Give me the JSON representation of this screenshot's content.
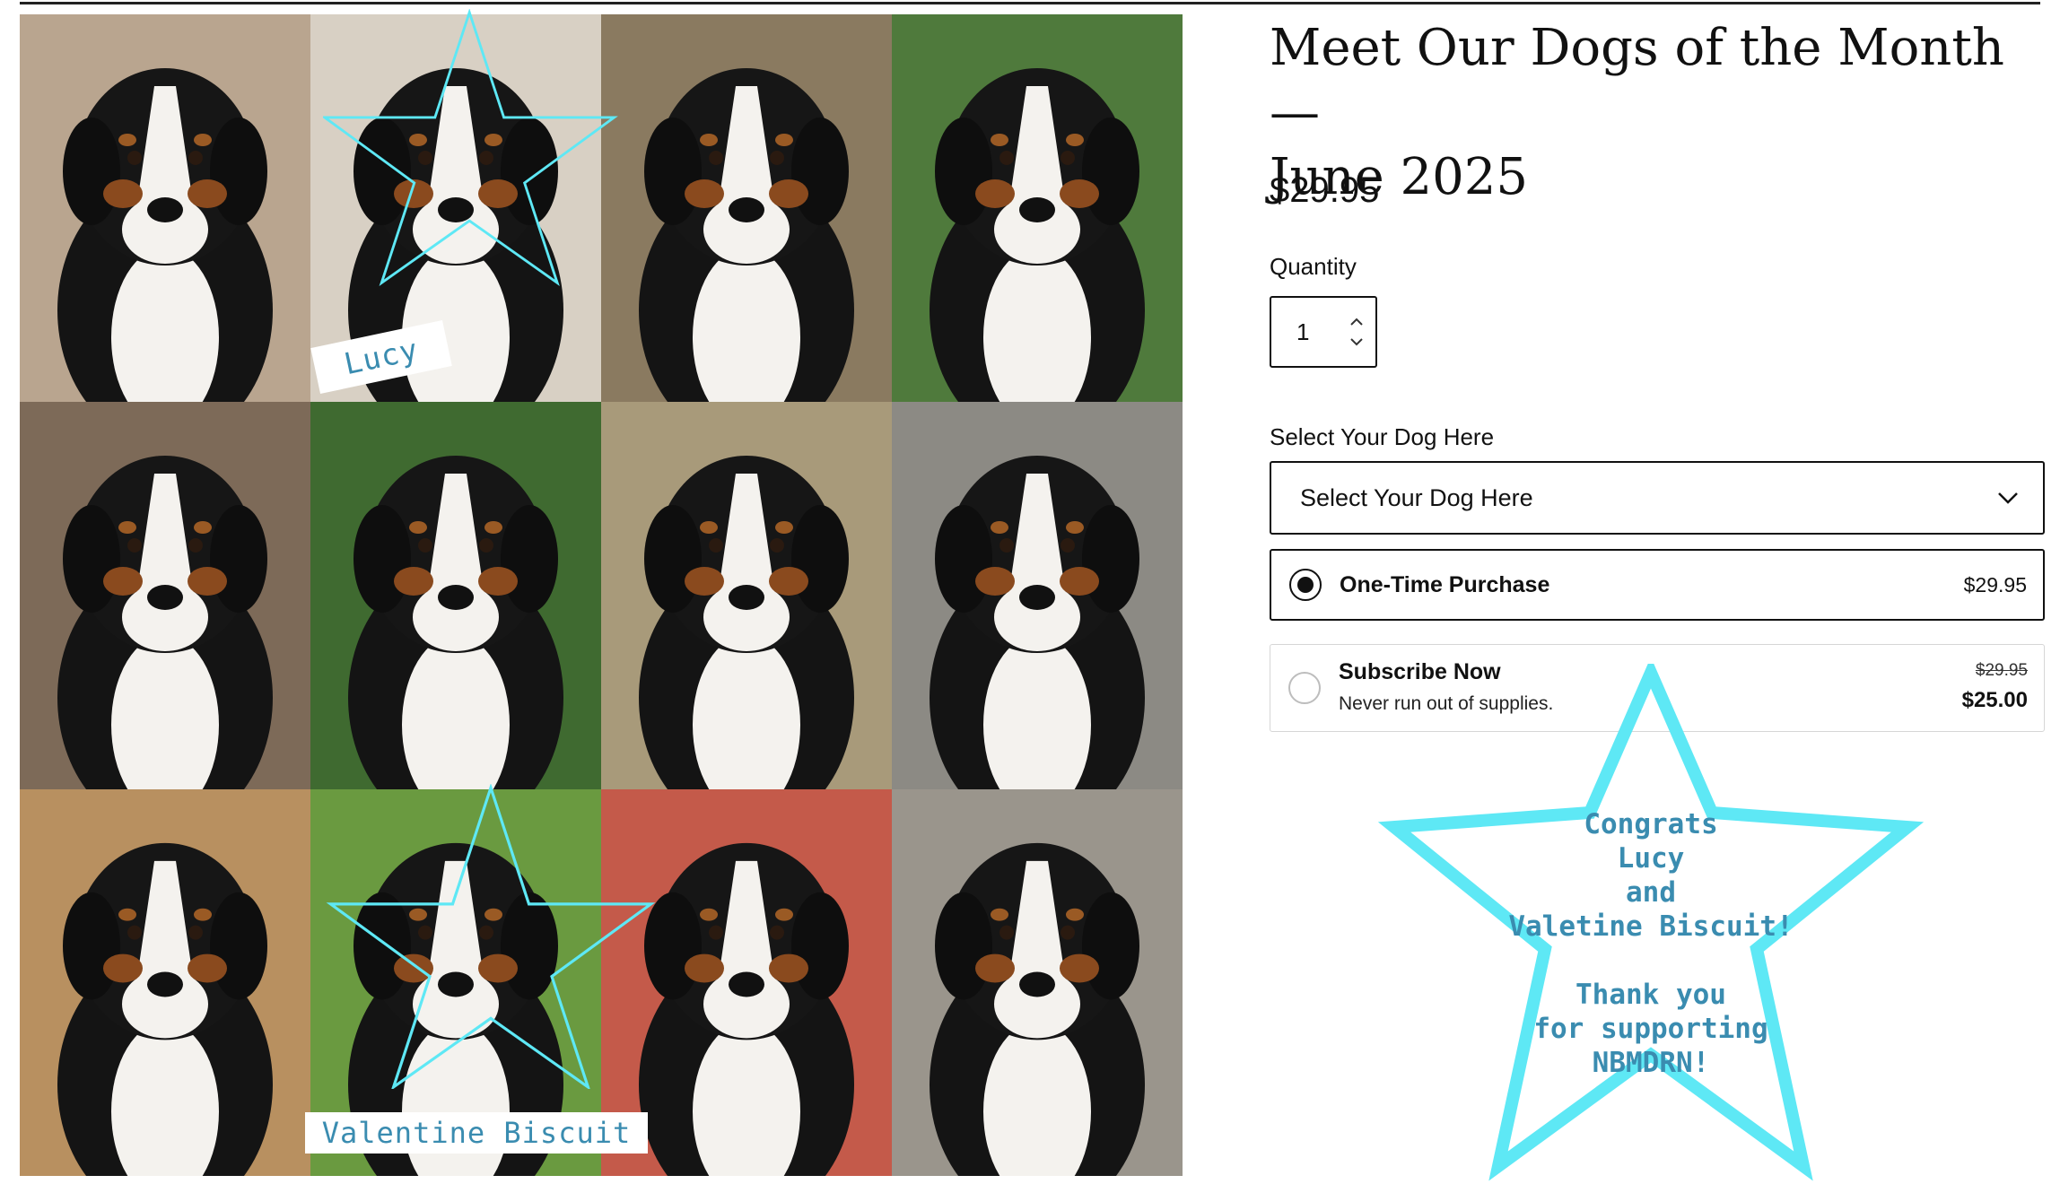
{
  "product": {
    "title_line1": "Meet Our Dogs of the Month —",
    "title_line2": "June 2025",
    "price": "$29.95",
    "quantity_label": "Quantity",
    "quantity_value": "1",
    "select_label": "Select Your Dog Here",
    "select_value": "Select Your Dog Here",
    "options": [
      {
        "name": "One-Time Purchase",
        "price": "$29.95",
        "selected": true
      },
      {
        "name": "Subscribe Now",
        "description": "Never run out of supplies.",
        "old_price": "$29.95",
        "price": "$25.00",
        "selected": false
      }
    ]
  },
  "gallery": {
    "caption_lucy": "Lucy",
    "caption_valentine": "Valentine Biscuit",
    "dogs": [
      {
        "name": "dog-photo-1",
        "bg": "#b9a58f"
      },
      {
        "name": "dog-photo-lucy",
        "bg": "#d8d0c4"
      },
      {
        "name": "dog-photo-3",
        "bg": "#8a7a60"
      },
      {
        "name": "dog-photo-4",
        "bg": "#4f7a3c"
      },
      {
        "name": "dog-photo-5",
        "bg": "#7d6a58"
      },
      {
        "name": "dog-photo-6",
        "bg": "#3f6a30"
      },
      {
        "name": "dog-photo-7",
        "bg": "#a89a7a"
      },
      {
        "name": "dog-photo-8",
        "bg": "#8c8a84"
      },
      {
        "name": "dog-photo-9",
        "bg": "#b89060"
      },
      {
        "name": "dog-photo-valentine",
        "bg": "#6a9a40"
      },
      {
        "name": "dog-photo-11",
        "bg": "#c45a4a"
      },
      {
        "name": "dog-photo-12",
        "bg": "#9a958c"
      }
    ]
  },
  "congrats": {
    "lines": [
      "Congrats",
      "Lucy",
      "and",
      "Valetine Biscuit!",
      "",
      "Thank you",
      "for supporting",
      "NBMDRN!"
    ]
  },
  "colors": {
    "star": "#5ee8f5",
    "caption_text": "#3a8cb0",
    "text": "#111111"
  }
}
